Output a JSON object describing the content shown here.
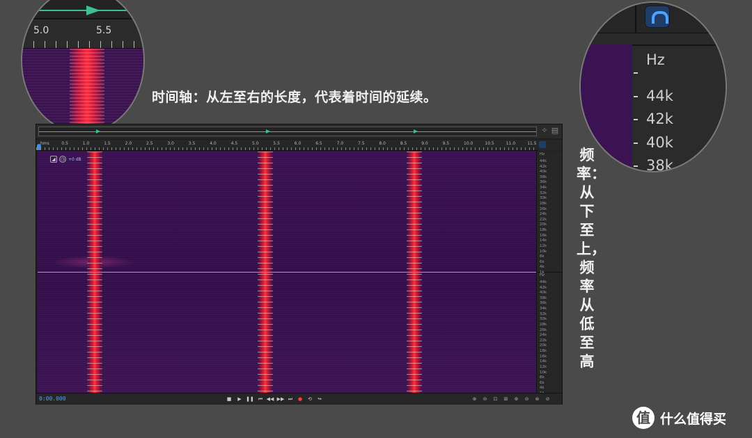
{
  "captions": {
    "time_axis": "时间轴：从左至右的长度，代表着时间的延续。",
    "frequency": "频率：从下至上，频率从低至高"
  },
  "magnifier_left": {
    "tick_labels": [
      "5.0",
      "5.5"
    ]
  },
  "magnifier_right": {
    "unit": "Hz",
    "labels": [
      "44k",
      "42k",
      "40k",
      "38k"
    ]
  },
  "editor": {
    "ruler": {
      "labels": [
        "hms",
        "0.5",
        "1.0",
        "1.5",
        "2.0",
        "2.5",
        "3.0",
        "3.5",
        "4.0",
        "4.5",
        "5.0",
        "5.5",
        "6.0",
        "6.5",
        "7.0",
        "7.5",
        "8.0",
        "8.5",
        "9.0",
        "9.5",
        "10.0",
        "10.5",
        "11.0",
        "11.5"
      ]
    },
    "hud_text": "+0 dB",
    "hz_scale": {
      "unit": "Hz",
      "labels": [
        "44k",
        "42k",
        "40k",
        "38k",
        "36k",
        "34k",
        "32k",
        "30k",
        "28k",
        "26k",
        "24k",
        "22k",
        "20k",
        "18k",
        "16k",
        "14k",
        "12k",
        "10k",
        "8k",
        "6k",
        "4k",
        "1k"
      ]
    },
    "transport": {
      "time": "0:00.000",
      "buttons": [
        "stop",
        "play",
        "pause",
        "go-to-start",
        "rewind",
        "fast-forward",
        "go-to-end",
        "record",
        "loop",
        "skip"
      ],
      "zoom_buttons": [
        "zoom-in-amplitude",
        "zoom-out-amplitude",
        "zoom-to-selection",
        "zoom-in-time",
        "zoom-in",
        "zoom-out",
        "zoom-full"
      ]
    },
    "colors": {
      "spectrogram_bg": "#3a1052",
      "energy_peak": "#ff3a3a",
      "playhead": "#3f8fe6",
      "overview_line": "#3fbf8f"
    }
  },
  "watermark": {
    "logo": "值",
    "text": "什么值得买"
  }
}
